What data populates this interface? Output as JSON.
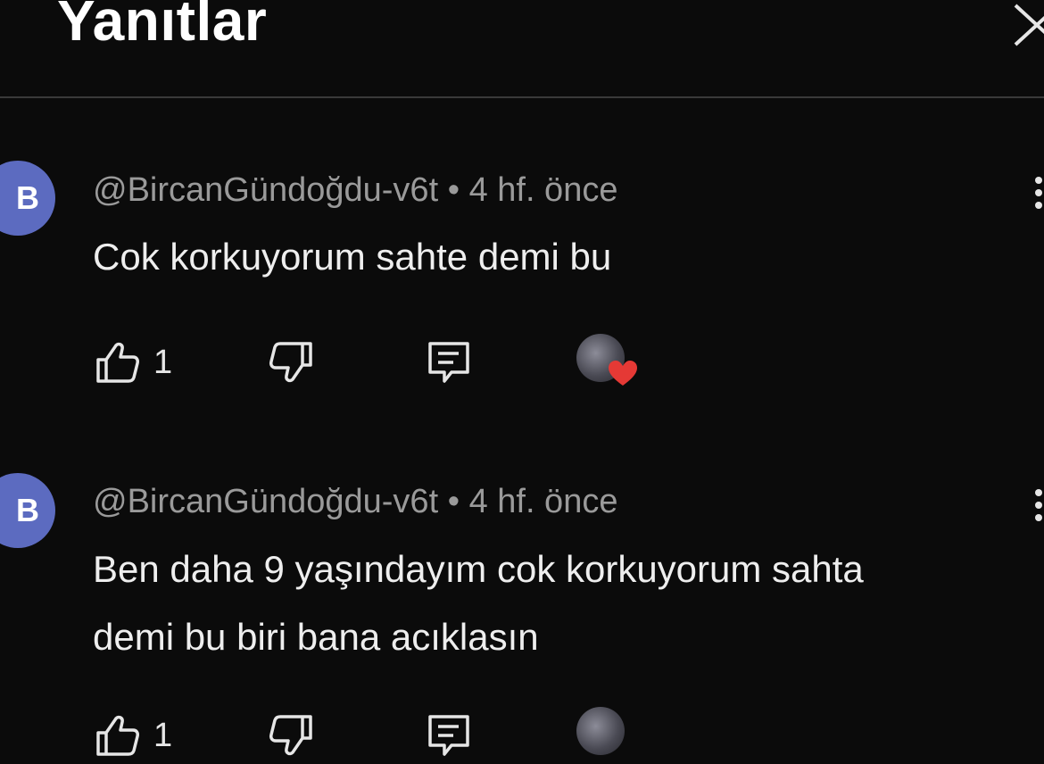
{
  "header": {
    "title": "Yanıtlar"
  },
  "comments": [
    {
      "avatar_letter": "B",
      "author": "@BircanGündoğdu-v6t",
      "separator": "•",
      "time": "4 hf. önce",
      "text": "Cok korkuyorum sahte demi bu",
      "like_count": "1"
    },
    {
      "avatar_letter": "B",
      "author": "@BircanGündoğdu-v6t",
      "separator": "•",
      "time": "4 hf. önce",
      "text": "Ben daha 9 yaşındayım cok korkuyorum sahta demi bu biri bana acıklasın",
      "like_count": "1"
    }
  ],
  "colors": {
    "background": "#0b0b0b",
    "avatar": "#5c6bc0",
    "heart": "#e53935",
    "meta_text": "#9a9a9a"
  },
  "icons": [
    "close-icon",
    "thumbs-up-icon",
    "thumbs-down-icon",
    "reply-icon",
    "creator-heart-icon",
    "more-vert-icon"
  ]
}
